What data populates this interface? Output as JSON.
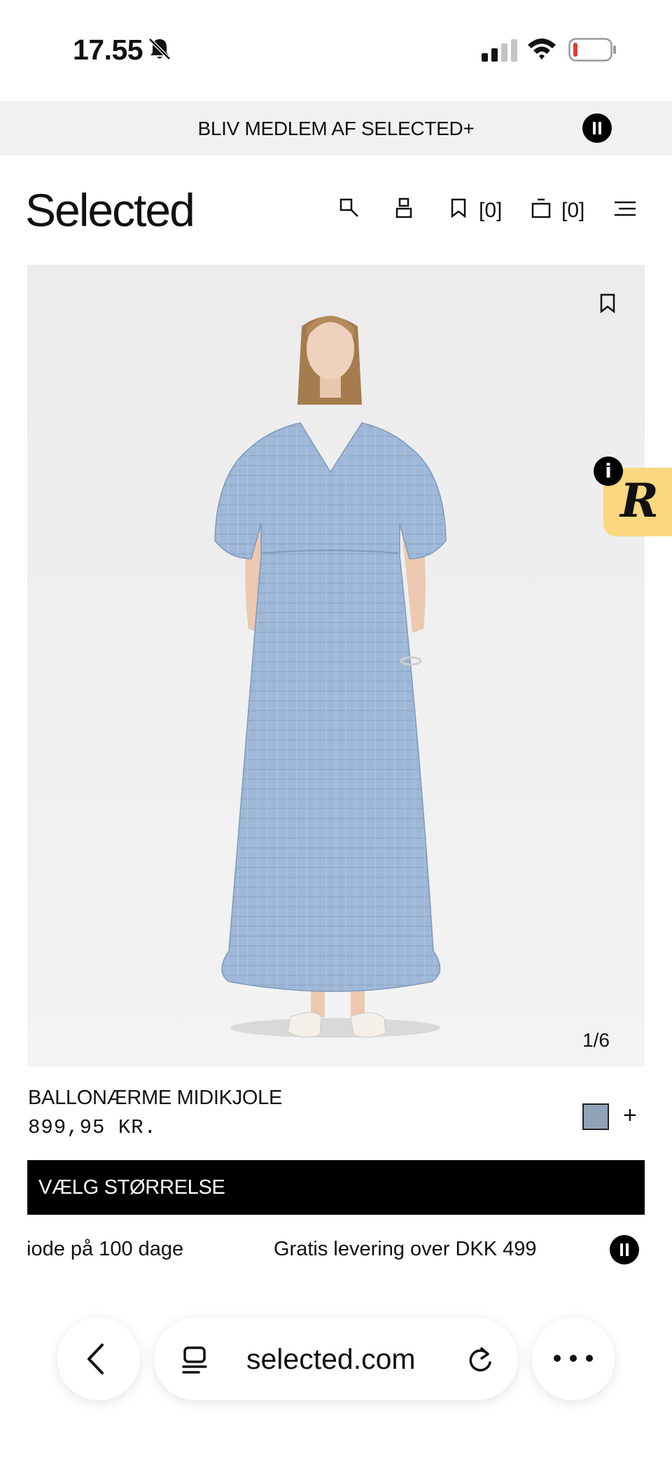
{
  "status_bar": {
    "time": "17.55",
    "icons": [
      "bell-slash-icon",
      "signal-icon",
      "wifi-icon",
      "battery-low-icon"
    ],
    "battery_color": "#e53935"
  },
  "promo": {
    "text": "BLIV MEDLEM AF SELECTED+",
    "pause_icon": "pause-icon"
  },
  "header": {
    "logo": "Selected",
    "icons": [
      "search-icon",
      "account-icon",
      "wishlist-icon",
      "bag-icon",
      "menu-icon"
    ],
    "wishlist_count": "[0]",
    "bag_count": "[0]"
  },
  "product": {
    "image_counter": "1/6",
    "name": "BALLONÆRME MIDIKJOLE",
    "price": "899,95 KR.",
    "swatch_color": "#8fa2b8",
    "add_color": "+",
    "size_button_label": "VÆLG STØRRELSE",
    "dress_color": "#9fb8d8"
  },
  "widget": {
    "letter": "R",
    "info": "i",
    "bg_color": "#fbd780"
  },
  "ticker": {
    "items": [
      "iode på 100 dage",
      "Gratis levering over DKK 499"
    ]
  },
  "browser": {
    "url": "selected.com",
    "icons": [
      "back-icon",
      "tabs-icon",
      "reload-icon",
      "more-icon"
    ]
  }
}
